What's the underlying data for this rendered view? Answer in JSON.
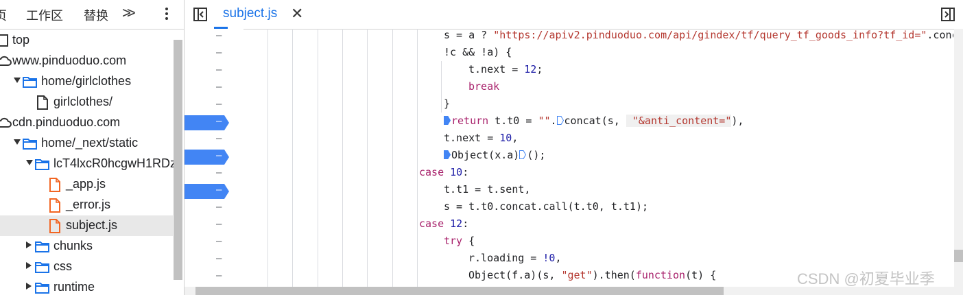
{
  "navigator": {
    "tabs": [
      "页",
      "工作区",
      "替换"
    ],
    "more_tabs": "»",
    "menu": "⋮"
  },
  "tree": [
    {
      "label": "top",
      "icon": "frame-icon",
      "expander": "none"
    },
    {
      "label": "www.pinduoduo.com",
      "icon": "cloud-icon",
      "expander": "none"
    },
    {
      "label": "home/girlclothes",
      "icon": "folder-icon",
      "expander": "open"
    },
    {
      "label": "girlclothes/",
      "icon": "file-icon",
      "expander": "none"
    },
    {
      "label": "cdn.pinduoduo.com",
      "icon": "cloud-icon",
      "expander": "none"
    },
    {
      "label": "home/_next/static",
      "icon": "folder-icon",
      "expander": "open"
    },
    {
      "label": "lcT4lxcR0hcgwH1RDz",
      "icon": "folder-icon",
      "expander": "open"
    },
    {
      "label": "_app.js",
      "icon": "js-file-icon",
      "expander": "none"
    },
    {
      "label": "_error.js",
      "icon": "js-file-icon",
      "expander": "none"
    },
    {
      "label": "subject.js",
      "icon": "js-file-icon",
      "expander": "none",
      "selected": true
    },
    {
      "label": "chunks",
      "icon": "folder-icon",
      "expander": "closed"
    },
    {
      "label": "css",
      "icon": "folder-icon",
      "expander": "closed"
    },
    {
      "label": "runtime",
      "icon": "folder-icon",
      "expander": "closed"
    }
  ],
  "editor": {
    "tab_label": "subject.js",
    "close_glyph": "✕"
  },
  "gutter": {
    "line_marks": [
      "–",
      "–",
      "–",
      "–",
      "–",
      "–",
      "–",
      "–",
      "–",
      "–",
      "–",
      "–",
      "–",
      "–",
      "–"
    ],
    "breakpoint_rows": [
      5,
      7,
      9
    ]
  },
  "code_lines": [
    {
      "tokens": [
        [
          "s = a ? ",
          ""
        ],
        [
          "\"https://apiv2.pinduoduo.com/api/gindex/tf/query_tf_goods_info?tf_id=\"",
          "str"
        ],
        [
          ".conc",
          ""
        ]
      ]
    },
    {
      "tokens": [
        [
          "!c && !a) {",
          ""
        ]
      ]
    },
    {
      "tokens": [
        [
          "t.next = ",
          ""
        ],
        [
          "12",
          "num"
        ],
        [
          ";",
          ""
        ]
      ]
    },
    {
      "tokens": [
        [
          "break",
          "kw"
        ]
      ]
    },
    {
      "tokens": [
        [
          "}",
          ""
        ]
      ]
    },
    {
      "tokens": [
        [
          "PAUSE",
          ""
        ],
        [
          "return",
          "kw"
        ],
        [
          " t.t0 = ",
          ""
        ],
        [
          "\"\"",
          "str"
        ],
        [
          ".",
          ""
        ],
        [
          "PAUSE",
          ""
        ],
        [
          "concat(s, ",
          ""
        ],
        [
          " \"&anti_content=\"",
          "str hl"
        ],
        [
          "),",
          ""
        ]
      ]
    },
    {
      "tokens": [
        [
          "t.next = ",
          ""
        ],
        [
          "10",
          "num"
        ],
        [
          ",",
          ""
        ]
      ]
    },
    {
      "tokens": [
        [
          "PAUSE",
          ""
        ],
        [
          "Object(x.a)",
          ""
        ],
        [
          "PAUSE",
          ""
        ],
        [
          "();",
          ""
        ]
      ]
    },
    {
      "tokens": [
        [
          "case",
          "kw"
        ],
        [
          " ",
          ""
        ],
        [
          "10",
          "num"
        ],
        [
          ":",
          ""
        ]
      ]
    },
    {
      "tokens": [
        [
          "t.t1 = t.sent,",
          ""
        ]
      ]
    },
    {
      "tokens": [
        [
          "s = t.t0.concat.call(t.t0, t.t1);",
          ""
        ]
      ]
    },
    {
      "tokens": [
        [
          "case",
          "kw"
        ],
        [
          " ",
          ""
        ],
        [
          "12",
          "num"
        ],
        [
          ":",
          ""
        ]
      ]
    },
    {
      "tokens": [
        [
          "try",
          "kw"
        ],
        [
          " {",
          ""
        ]
      ]
    },
    {
      "tokens": [
        [
          "r.loading = ",
          ""
        ],
        [
          "!0",
          "num"
        ],
        [
          ",",
          ""
        ]
      ]
    },
    {
      "tokens": [
        [
          "Object(f.a)(s, ",
          ""
        ],
        [
          "\"get\"",
          "str"
        ],
        [
          ").then(",
          ""
        ],
        [
          "function",
          "kw"
        ],
        [
          "(t) {",
          ""
        ]
      ]
    }
  ],
  "code_indents": [
    8,
    8,
    9,
    9,
    8,
    8,
    8,
    8,
    7,
    8,
    8,
    7,
    8,
    9,
    9
  ],
  "watermark": "CSDN @初夏毕业季",
  "colors": {
    "accent": "#1a73e8",
    "breakpoint": "#4285f4",
    "keyword": "#a8216b",
    "string": "#b4372f",
    "number": "#1a1aa6"
  }
}
